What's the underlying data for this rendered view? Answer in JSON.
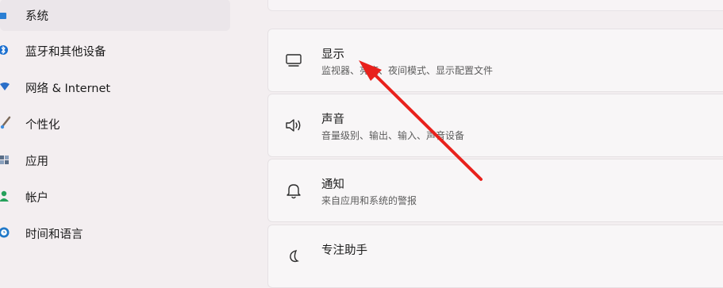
{
  "sidebar": {
    "items": [
      {
        "label": "系统",
        "icon": "monitor-icon",
        "active": true
      },
      {
        "label": "蓝牙和其他设备",
        "icon": "bluetooth-icon"
      },
      {
        "label": "网络 & Internet",
        "icon": "wifi-icon"
      },
      {
        "label": "个性化",
        "icon": "brush-icon"
      },
      {
        "label": "应用",
        "icon": "apps-icon"
      },
      {
        "label": "帐户",
        "icon": "person-icon"
      },
      {
        "label": "时间和语言",
        "icon": "globe-clock-icon"
      }
    ]
  },
  "main": {
    "cards": [
      {
        "title": "显示",
        "desc": "监视器、亮度、夜间模式、显示配置文件",
        "icon": "display-icon"
      },
      {
        "title": "声音",
        "desc": "音量级别、输出、输入、声音设备",
        "icon": "speaker-icon"
      },
      {
        "title": "通知",
        "desc": "来自应用和系统的警报",
        "icon": "bell-icon"
      },
      {
        "title": "专注助手",
        "icon": "moon-icon"
      }
    ]
  },
  "colors": {
    "accent_blue": "#0067c0",
    "arrow_red": "#e8211c",
    "background": "#f3eef0"
  }
}
